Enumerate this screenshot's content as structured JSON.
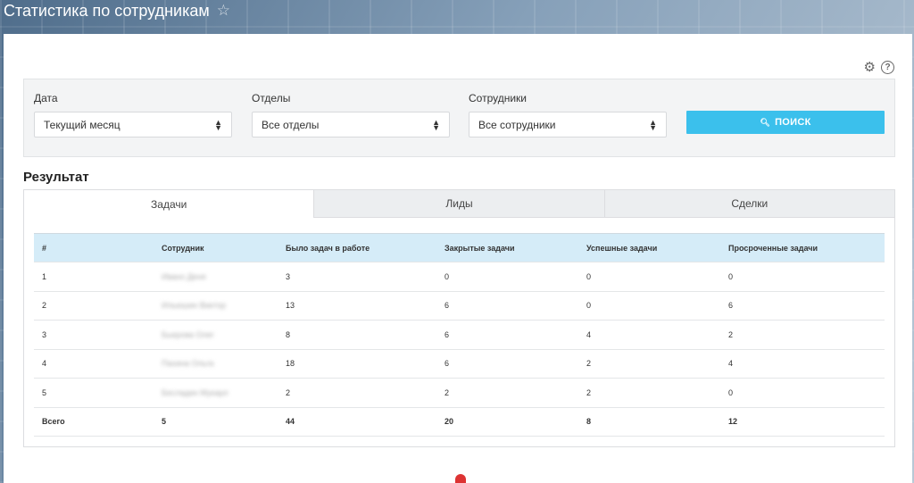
{
  "page": {
    "title": "Статистика по сотрудникам",
    "star_icon": "star-icon"
  },
  "toolbar": {
    "settings_icon": "gear-icon",
    "help_icon": "help-icon"
  },
  "filters": {
    "date": {
      "label": "Дата",
      "value": "Текущий месяц"
    },
    "departments": {
      "label": "Отделы",
      "value": "Все отделы"
    },
    "employees": {
      "label": "Сотрудники",
      "value": "Все сотрудники"
    },
    "search_label": "ПОИСК"
  },
  "result": {
    "title": "Результат",
    "tabs": [
      {
        "label": "Задачи",
        "active": true
      },
      {
        "label": "Лиды",
        "active": false
      },
      {
        "label": "Сделки",
        "active": false
      }
    ]
  },
  "table": {
    "headers": [
      "#",
      "Сотрудник",
      "Было задач в работе",
      "Закрытые задачи",
      "Успешные задачи",
      "Просроченные задачи"
    ],
    "rows": [
      [
        "1",
        "Ивано Деня",
        "3",
        "0",
        "0",
        "0"
      ],
      [
        "2",
        "Ильюшин Виктор",
        "13",
        "6",
        "0",
        "6"
      ],
      [
        "3",
        "Быкрова Олег",
        "8",
        "6",
        "4",
        "2"
      ],
      [
        "4",
        "Пахина Ольга",
        "18",
        "6",
        "2",
        "4"
      ],
      [
        "5",
        "Бесладин Мукарл",
        "2",
        "2",
        "2",
        "0"
      ],
      [
        "Всего",
        "5",
        "44",
        "20",
        "8",
        "12"
      ]
    ]
  }
}
